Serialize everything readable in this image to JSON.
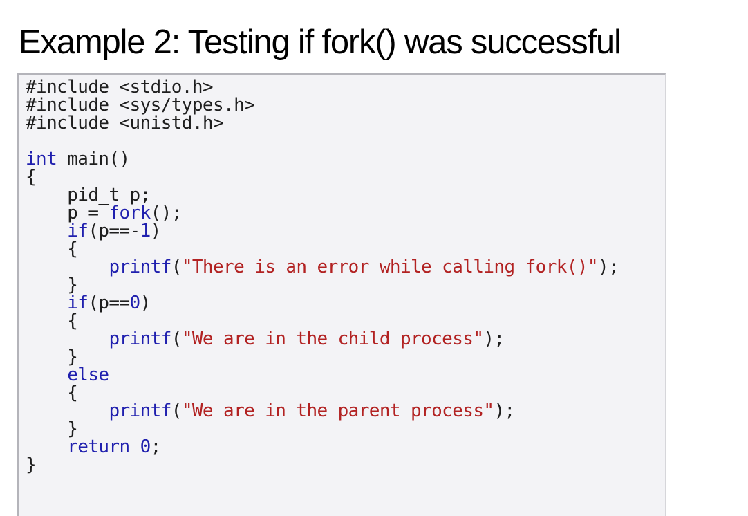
{
  "slide": {
    "title": "Example 2: Testing if fork() was successful"
  },
  "code": {
    "lines": [
      [
        {
          "t": "#include <stdio.h>",
          "c": "pp"
        }
      ],
      [
        {
          "t": "#include <sys/types.h>",
          "c": "pp"
        }
      ],
      [
        {
          "t": "#include <unistd.h>",
          "c": "pp"
        }
      ],
      [],
      [
        {
          "t": "int",
          "c": "kw"
        },
        {
          "t": " main()",
          "c": "plain"
        }
      ],
      [
        {
          "t": "{",
          "c": "plain"
        }
      ],
      [
        {
          "t": "    pid_t p;",
          "c": "plain"
        }
      ],
      [
        {
          "t": "    p = ",
          "c": "plain"
        },
        {
          "t": "fork",
          "c": "fn"
        },
        {
          "t": "();",
          "c": "plain"
        }
      ],
      [
        {
          "t": "    ",
          "c": "plain"
        },
        {
          "t": "if",
          "c": "kw"
        },
        {
          "t": "(p==-",
          "c": "plain"
        },
        {
          "t": "1",
          "c": "num"
        },
        {
          "t": ")",
          "c": "plain"
        }
      ],
      [
        {
          "t": "    {",
          "c": "plain"
        }
      ],
      [
        {
          "t": "        ",
          "c": "plain"
        },
        {
          "t": "printf",
          "c": "fn"
        },
        {
          "t": "(",
          "c": "plain"
        },
        {
          "t": "\"There is an error while calling fork()\"",
          "c": "str"
        },
        {
          "t": ");",
          "c": "plain"
        }
      ],
      [
        {
          "t": "    }",
          "c": "plain"
        }
      ],
      [
        {
          "t": "    ",
          "c": "plain"
        },
        {
          "t": "if",
          "c": "kw"
        },
        {
          "t": "(p==",
          "c": "plain"
        },
        {
          "t": "0",
          "c": "num"
        },
        {
          "t": ")",
          "c": "plain"
        }
      ],
      [
        {
          "t": "    {",
          "c": "plain"
        }
      ],
      [
        {
          "t": "        ",
          "c": "plain"
        },
        {
          "t": "printf",
          "c": "fn"
        },
        {
          "t": "(",
          "c": "plain"
        },
        {
          "t": "\"We are in the child process\"",
          "c": "str"
        },
        {
          "t": ");",
          "c": "plain"
        }
      ],
      [
        {
          "t": "    }",
          "c": "plain"
        }
      ],
      [
        {
          "t": "    ",
          "c": "plain"
        },
        {
          "t": "else",
          "c": "kw"
        }
      ],
      [
        {
          "t": "    {",
          "c": "plain"
        }
      ],
      [
        {
          "t": "        ",
          "c": "plain"
        },
        {
          "t": "printf",
          "c": "fn"
        },
        {
          "t": "(",
          "c": "plain"
        },
        {
          "t": "\"We are in the parent process\"",
          "c": "str"
        },
        {
          "t": ");",
          "c": "plain"
        }
      ],
      [
        {
          "t": "    }",
          "c": "plain"
        }
      ],
      [
        {
          "t": "    ",
          "c": "plain"
        },
        {
          "t": "return",
          "c": "kw"
        },
        {
          "t": " ",
          "c": "plain"
        },
        {
          "t": "0",
          "c": "num"
        },
        {
          "t": ";",
          "c": "plain"
        }
      ],
      [
        {
          "t": "}",
          "c": "plain"
        }
      ]
    ]
  },
  "colors": {
    "keyword": "#1f1fae",
    "string": "#b22222",
    "text": "#1e1e1e",
    "panel_background": "#f3f3f6",
    "panel_border": "#b4b4ba"
  }
}
